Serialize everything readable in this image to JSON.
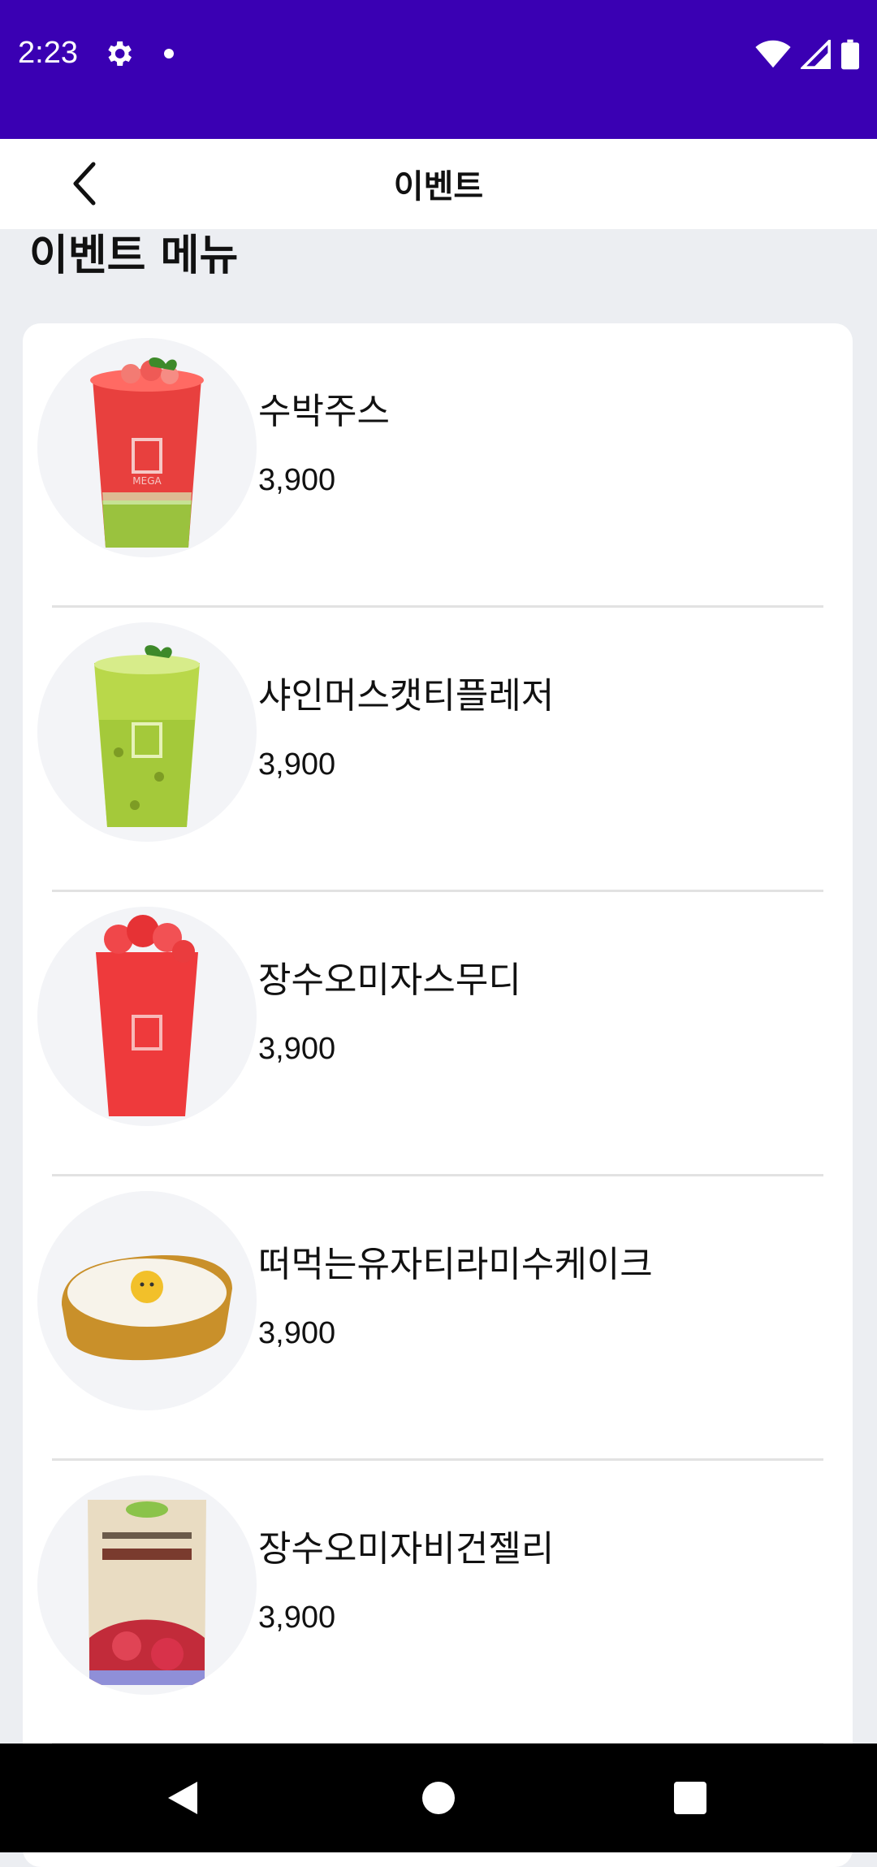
{
  "status": {
    "time": "2:23",
    "icons": [
      "gear-icon",
      "notification-dot-icon",
      "wifi-icon",
      "signal-icon",
      "battery-icon"
    ]
  },
  "appbar": {
    "title": "이벤트",
    "back_icon": "chevron-left-icon"
  },
  "section": {
    "title": "이벤트 메뉴"
  },
  "menu_items": [
    {
      "name": "수박주스",
      "price": "3,900",
      "image": "watermelon-juice-cup"
    },
    {
      "name": "샤인머스캣티플레저",
      "price": "3,900",
      "image": "shine-muscat-tea-cup"
    },
    {
      "name": "장수오미자스무디",
      "price": "3,900",
      "image": "omija-smoothie-cup"
    },
    {
      "name": "떠먹는유자티라미수케이크",
      "price": "3,900",
      "image": "yuzu-tiramisu-cake-tray"
    },
    {
      "name": "장수오미자비건젤리",
      "price": "3,900",
      "image": "omija-vegan-jelly-pouch"
    }
  ],
  "colors": {
    "status_bar": "#3a00b3",
    "background": "#eceef2",
    "card": "#ffffff"
  },
  "navbar": {
    "icons": [
      "back-triangle-icon",
      "home-circle-icon",
      "recents-square-icon"
    ]
  }
}
